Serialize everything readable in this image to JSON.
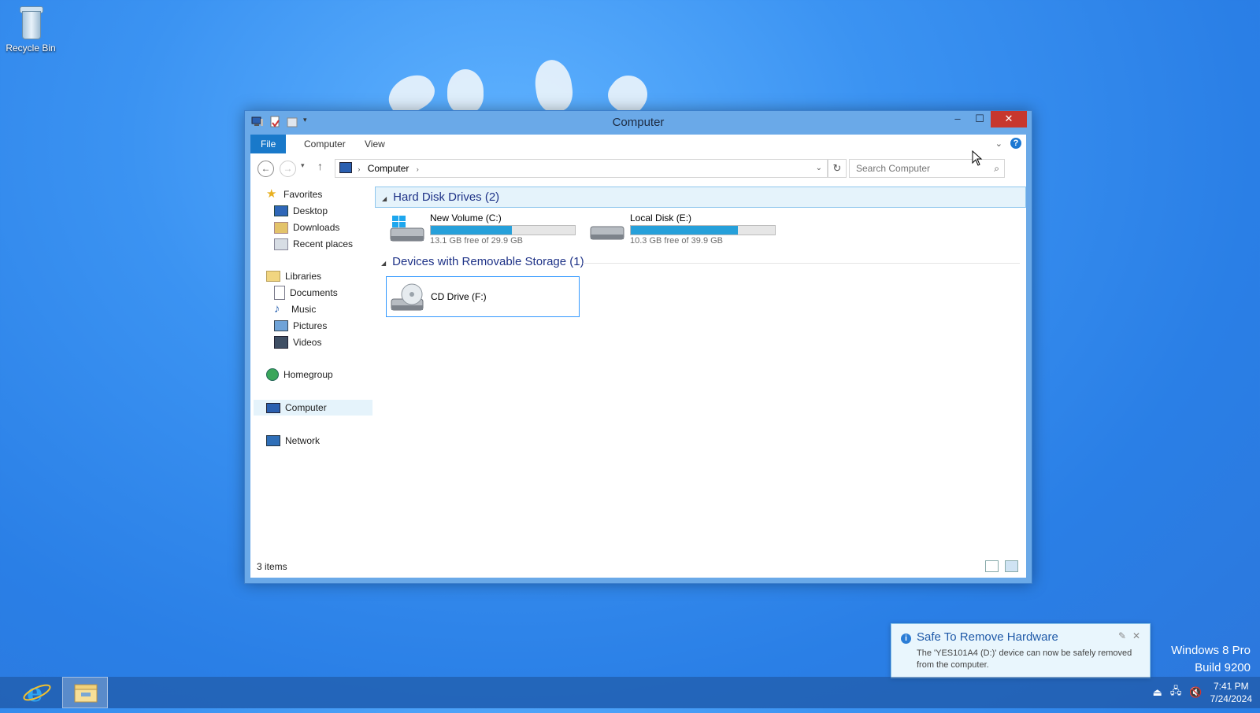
{
  "desktop": {
    "icons": [
      {
        "label": "Recycle Bin",
        "icon": "recycle-bin-icon"
      }
    ],
    "watermark": {
      "line1": "Windows 8 Pro",
      "line2": "Build 9200"
    }
  },
  "window": {
    "title": "Computer",
    "controls": {
      "minimize": "–",
      "maximize": "☐",
      "close": "✕"
    },
    "ribbon_tabs": [
      {
        "label": "File",
        "active": true
      },
      {
        "label": "Computer",
        "active": false
      },
      {
        "label": "View",
        "active": false
      }
    ],
    "address": {
      "path": [
        "Computer"
      ]
    },
    "search": {
      "placeholder": "Search Computer"
    },
    "nav": {
      "favorites": {
        "label": "Favorites",
        "items": [
          "Desktop",
          "Downloads",
          "Recent places"
        ]
      },
      "libraries": {
        "label": "Libraries",
        "items": [
          "Documents",
          "Music",
          "Pictures",
          "Videos"
        ]
      },
      "homegroup": "Homegroup",
      "computer": "Computer",
      "network": "Network"
    },
    "groups": {
      "hdd": {
        "header": "Hard Disk Drives (2)",
        "drives": [
          {
            "name": "New Volume (C:)",
            "free": "13.1 GB free of 29.9 GB",
            "used_fraction": 0.562
          },
          {
            "name": "Local Disk (E:)",
            "free": "10.3 GB free of 39.9 GB",
            "used_fraction": 0.742
          }
        ]
      },
      "removable": {
        "header": "Devices with Removable Storage (1)",
        "drives": [
          {
            "name": "CD Drive (F:)"
          }
        ]
      }
    },
    "status": {
      "count": "3 items"
    }
  },
  "notification": {
    "title": "Safe To Remove Hardware",
    "body": "The 'YES101A4 (D:)' device can now be safely removed from the computer."
  },
  "taskbar": {
    "clock": {
      "time": "7:41 PM",
      "date": "7/24/2024"
    }
  },
  "colors": {
    "accent": "#1979ca",
    "progress": "#26a0da",
    "close": "#c7372e"
  }
}
